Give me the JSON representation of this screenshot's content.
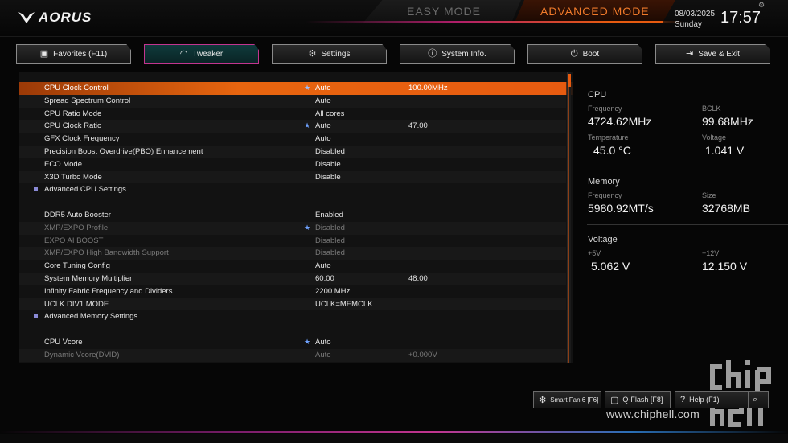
{
  "brand": {
    "logo_text": "AORUS"
  },
  "modes": {
    "easy": "EASY MODE",
    "advanced": "ADVANCED MODE"
  },
  "datetime": {
    "date": "08/03/2025",
    "day": "Sunday",
    "time": "17:57"
  },
  "tabs": [
    {
      "label": "Favorites (F11)",
      "icon": "folder-star-icon"
    },
    {
      "label": "Tweaker",
      "icon": "speedometer-icon",
      "active": true
    },
    {
      "label": "Settings",
      "icon": "gear-icon"
    },
    {
      "label": "System Info.",
      "icon": "info-icon"
    },
    {
      "label": "Boot",
      "icon": "power-icon"
    },
    {
      "label": "Save & Exit",
      "icon": "exit-icon"
    }
  ],
  "settings": [
    {
      "name": "CPU Clock Control",
      "value": "Auto",
      "value2": "100.00MHz",
      "star": true,
      "selected": true
    },
    {
      "name": "Spread Spectrum Control",
      "value": "Auto"
    },
    {
      "name": "CPU Ratio Mode",
      "value": "All cores"
    },
    {
      "name": "CPU Clock Ratio",
      "value": "Auto",
      "value2": "47.00",
      "star": true
    },
    {
      "name": "GFX Clock Frequency",
      "value": "Auto"
    },
    {
      "name": "Precision Boost Overdrive(PBO) Enhancement",
      "value": "Disabled"
    },
    {
      "name": "ECO Mode",
      "value": "Disable"
    },
    {
      "name": "X3D Turbo Mode",
      "value": "Disable"
    },
    {
      "name": "Advanced CPU Settings",
      "submenu": true
    },
    {
      "blank": true
    },
    {
      "name": "DDR5 Auto Booster",
      "value": "Enabled"
    },
    {
      "name": "XMP/EXPO Profile",
      "value": "Disabled",
      "star": true,
      "dim": true
    },
    {
      "name": "EXPO AI BOOST",
      "value": "Disabled",
      "dim": true
    },
    {
      "name": "XMP/EXPO High Bandwidth Support",
      "value": "Disabled",
      "dim": true
    },
    {
      "name": "Core Tuning Config",
      "value": "Auto"
    },
    {
      "name": "System Memory Multiplier",
      "value": "60.00",
      "value2": "48.00"
    },
    {
      "name": "Infinity Fabric Frequency and Dividers",
      "value": "2200 MHz"
    },
    {
      "name": "UCLK DIV1 MODE",
      "value": "UCLK=MEMCLK"
    },
    {
      "name": "Advanced Memory Settings",
      "submenu": true
    },
    {
      "blank": true
    },
    {
      "name": "CPU Vcore",
      "value": "Auto",
      "star": true
    },
    {
      "name": "Dynamic Vcore(DVID)",
      "value": "Auto",
      "value2": "+0.000V",
      "dim": true
    }
  ],
  "scroll": {
    "position_fraction": 0.0
  },
  "panel": {
    "cpu": {
      "title": "CPU",
      "frequency_label": "Frequency",
      "frequency": "4724.62MHz",
      "bclk_label": "BCLK",
      "bclk": "99.68MHz",
      "temperature_label": "Temperature",
      "temperature": "45.0 °C",
      "voltage_label": "Voltage",
      "voltage": "1.041 V"
    },
    "memory": {
      "title": "Memory",
      "frequency_label": "Frequency",
      "frequency": "5980.92MT/s",
      "size_label": "Size",
      "size": "32768MB"
    },
    "voltage": {
      "title": "Voltage",
      "p5_label": "+5V",
      "p5": "5.062 V",
      "p12_label": "+12V",
      "p12": "12.150 V"
    }
  },
  "bottom": {
    "smart_fan": "Smart Fan 6 [F6]",
    "qflash": "Q-Flash [F8]",
    "help": "Help (F1)"
  },
  "watermark": {
    "url": "www.chiphell.com"
  },
  "colors": {
    "accent": "#e75b10",
    "tab_active_border": "#c2358f",
    "star": "#6fa2ff"
  }
}
